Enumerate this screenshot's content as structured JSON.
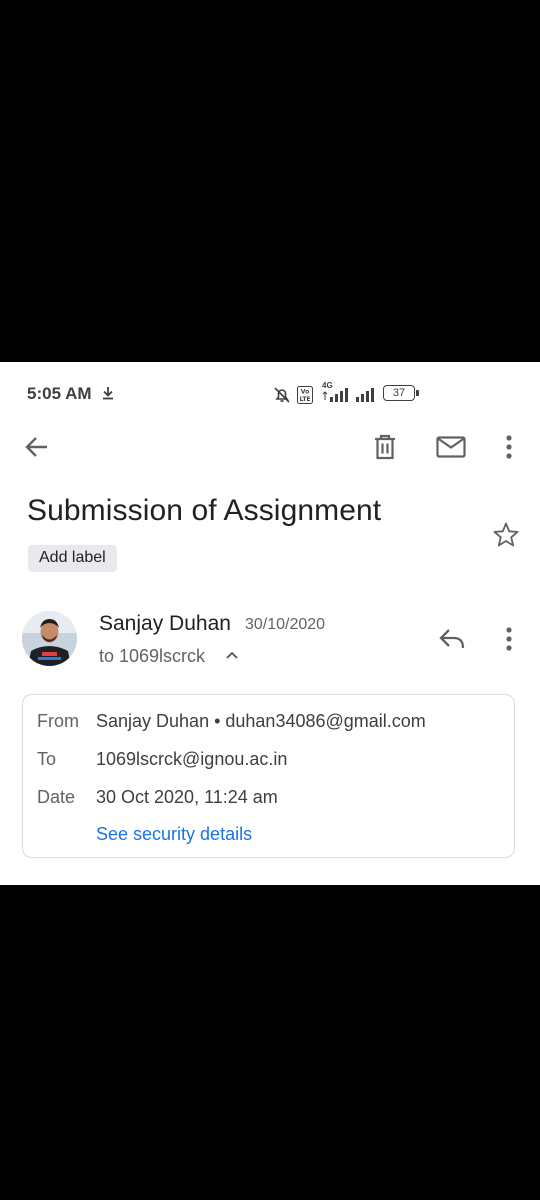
{
  "status_bar": {
    "time": "5:05 AM",
    "network": "4G",
    "battery": "37"
  },
  "toolbar": {
    "back_icon": "arrow-left-icon",
    "delete_icon": "trash-icon",
    "mark_unread_icon": "mail-icon",
    "more_icon": "more-vertical-icon"
  },
  "email": {
    "subject": "Submission of Assignment",
    "label_button": "Add label",
    "sender": {
      "name": "Sanjay Duhan",
      "date": "30/10/2020",
      "to_summary": "to 1069lscrck"
    },
    "details": {
      "from_label": "From",
      "from_value": "Sanjay Duhan • duhan34086@gmail.com",
      "to_label": "To",
      "to_value": "1069lscrck@ignou.ac.in",
      "date_label": "Date",
      "date_value": "30 Oct 2020, 11:24 am",
      "security_link": "See security details"
    }
  },
  "colors": {
    "link": "#1a73e8",
    "text_primary": "#202124",
    "text_secondary": "#5f6368",
    "chip_bg": "#e8eaed"
  }
}
